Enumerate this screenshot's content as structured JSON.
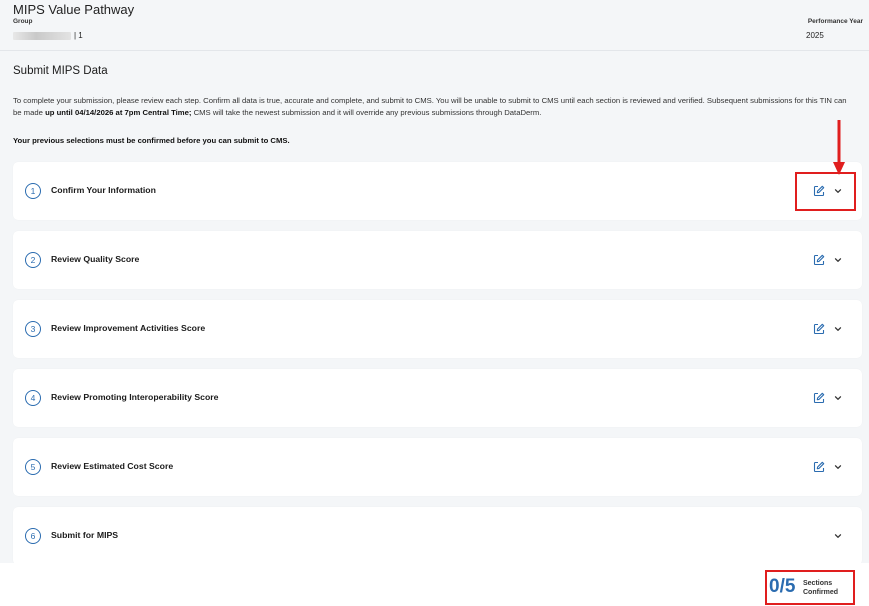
{
  "header": {
    "app_title": "MIPS Value Pathway",
    "group_label": "Group",
    "group_value_suffix": "| 1",
    "performance_year_label": "Performance Year",
    "performance_year": "2025"
  },
  "main": {
    "page_title": "Submit MIPS Data",
    "intro_part1": "To complete your submission, please review each step. Confirm all data is true, accurate and complete, and submit to CMS. You will be unable to submit to CMS until each section is reviewed and verified. Subsequent submissions for this TIN can be made ",
    "intro_bold": "up until 04/14/2026 at 7pm Central Time;",
    "intro_part2": " CMS will take the newest submission and it will override any previous submissions through DataDerm.",
    "notice": "Your previous selections must be confirmed before you can submit to CMS."
  },
  "steps": [
    {
      "number": "1",
      "label": "Confirm Your Information",
      "has_edit": true
    },
    {
      "number": "2",
      "label": "Review Quality Score",
      "has_edit": true
    },
    {
      "number": "3",
      "label": "Review Improvement Activities Score",
      "has_edit": true
    },
    {
      "number": "4",
      "label": "Review Promoting Interoperability Score",
      "has_edit": true
    },
    {
      "number": "5",
      "label": "Review Estimated Cost Score",
      "has_edit": true
    },
    {
      "number": "6",
      "label": "Submit for MIPS",
      "has_edit": false
    }
  ],
  "footer": {
    "count": "0/5",
    "count_label_line1": "Sections",
    "count_label_line2": "Confirmed"
  },
  "icons": {
    "edit": "edit-icon",
    "expand": "chevron-down-icon"
  },
  "colors": {
    "accent": "#2b6cb0",
    "annotation": "#e01e1e"
  }
}
